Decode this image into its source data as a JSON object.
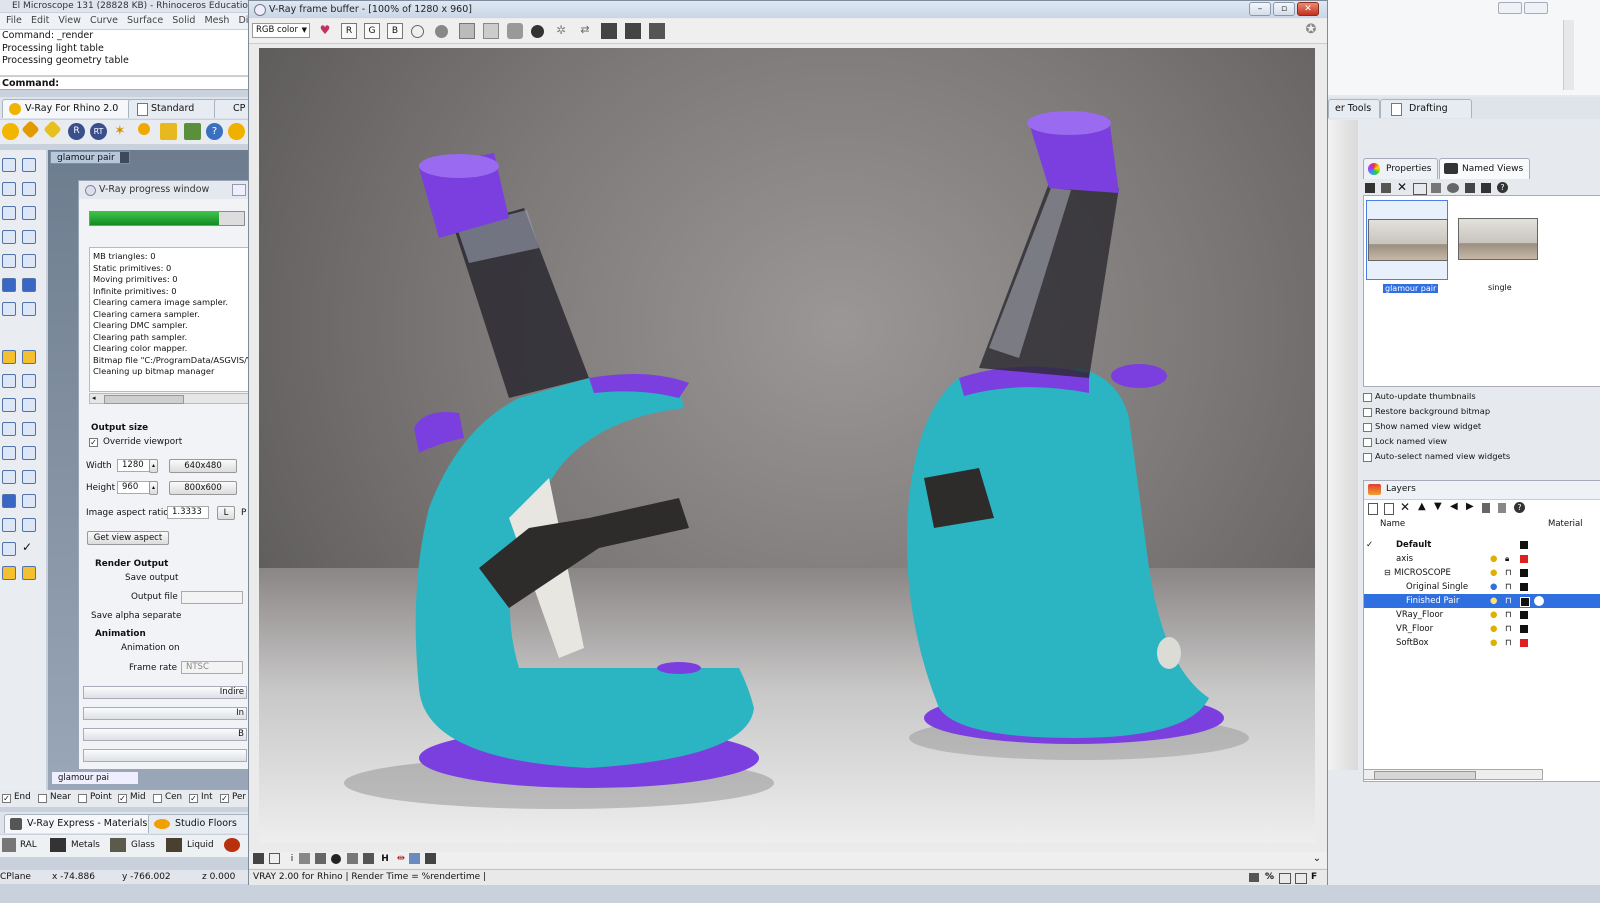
{
  "rhino": {
    "title": "El Microscope 131 (28828 KB) - Rhinoceros Education",
    "menu": [
      "File",
      "Edit",
      "View",
      "Curve",
      "Surface",
      "Solid",
      "Mesh",
      "Di"
    ],
    "command_history": [
      "Command: _render",
      "Processing light table",
      "Processing geometry table"
    ],
    "command_prompt": "Command:",
    "toolbar_tabs": [
      "V-Ray For Rhino 2.0",
      "Standard",
      "CP"
    ],
    "viewport_tab": "glamour pair",
    "viewport_tab_bottom": "glamour pai",
    "osnaps": [
      "End",
      "Near",
      "Point",
      "Mid",
      "Cen",
      "Int",
      "Per"
    ],
    "material_tabs": [
      "V-Ray Express - Materials",
      "Studio Floors"
    ],
    "materials": [
      "RAL",
      "Metals",
      "Glass",
      "Liquid"
    ],
    "status": {
      "cplane": "CPlane",
      "x": "x -74.886",
      "y": "y -766.002",
      "z": "z 0.000"
    }
  },
  "progress_window": {
    "title": "V-Ray progress window",
    "progress": 0.84,
    "log": [
      "MB triangles: 0",
      "Static primitives: 0",
      "Moving primitives: 0",
      "Infinite primitives: 0",
      "Clearing camera image sampler.",
      "Clearing camera sampler.",
      "Clearing DMC sampler.",
      "Clearing path sampler.",
      "Clearing color mapper.",
      "Bitmap file \"C:/ProgramData/ASGVIS/V",
      "Cleaning up bitmap manager"
    ],
    "output": {
      "heading": "Output size",
      "override_viewport": "Override viewport",
      "width_label": "Width",
      "width_value": "1280",
      "height_label": "Height",
      "height_value": "960",
      "preset_1": "640x480",
      "preset_2": "800x600",
      "aspect_label": "Image aspect ratio",
      "aspect_value": "1.3333",
      "lock": "L",
      "p": "P",
      "get_view_aspect": "Get view aspect"
    },
    "render_output": {
      "heading": "Render Output",
      "save_output": "Save output",
      "output_file": "Output file",
      "save_alpha": "Save alpha separate"
    },
    "animation": {
      "heading": "Animation",
      "animation_on": "Animation on",
      "frame_rate": "Frame rate",
      "frame_rate_value": "NTSC"
    },
    "rollouts": [
      "Indire",
      "In",
      "B"
    ]
  },
  "frame_buffer": {
    "title": "V-Ray frame buffer - [100% of 1280 x 960]",
    "channel": "RGB color",
    "channel_buttons": [
      "R",
      "G",
      "B"
    ],
    "bottom_toolbar_letters": [
      "i",
      "H"
    ],
    "status": "VRAY 2.00 for Rhino | Render Time = %rendertime |",
    "status_right": [
      "%",
      "F"
    ]
  },
  "right_panel": {
    "toolbar_tabs": [
      "er Tools",
      "Drafting"
    ],
    "panel_tabs": [
      "Properties",
      "Named Views"
    ],
    "named_views": [
      {
        "label": "glamour pair",
        "selected": true
      },
      {
        "label": "single",
        "selected": false
      }
    ],
    "options": [
      "Auto-update thumbnails",
      "Restore background bitmap",
      "Show named view widget",
      "Lock named view",
      "Auto-select named view widgets"
    ],
    "layers_title": "Layers",
    "layers_header": {
      "name": "Name",
      "material": "Material"
    },
    "layers": [
      {
        "name": "Default",
        "current": true,
        "color": "#111111"
      },
      {
        "name": "axis",
        "color": "#e02020"
      },
      {
        "name": "MICROSCOPE",
        "color": "#111111"
      },
      {
        "name": "Original Single",
        "color": "#111111"
      },
      {
        "name": "Finished Pair",
        "selected": true,
        "color": "#111111"
      },
      {
        "name": "VRay_Floor",
        "color": "#111111"
      },
      {
        "name": "VR_Floor",
        "color": "#111111"
      },
      {
        "name": "SoftBox",
        "color": "#e02020"
      }
    ]
  },
  "colors": {
    "microscope_body": "#2bb5c2",
    "microscope_accent": "#7b3fe0",
    "selection": "#2f6fe0"
  }
}
